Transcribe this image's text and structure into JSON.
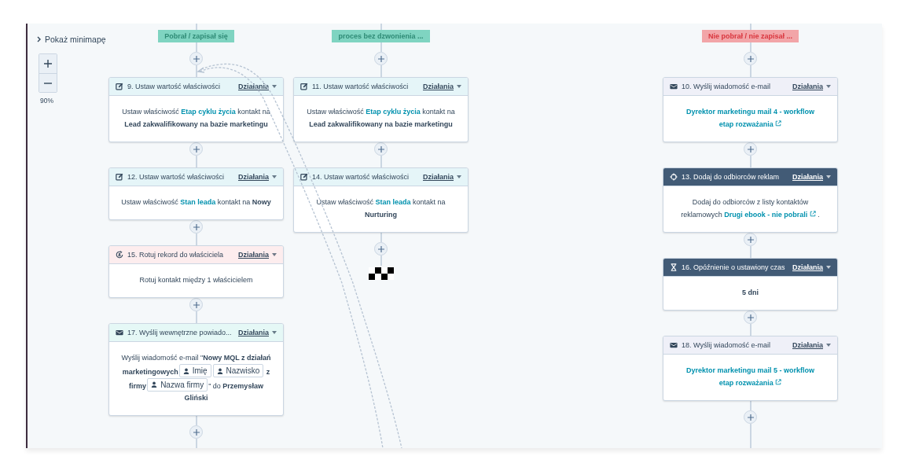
{
  "canvas": {
    "minimap_toggle": "Pokaż minimapę",
    "zoom_level": "90%"
  },
  "branches": [
    {
      "label": "Pobrał / zapisał się",
      "kind": "success",
      "ends": false,
      "steps": [
        {
          "title": "9. Ustaw wartość właściwości",
          "kind": "set_property",
          "actions": "Działania",
          "body": [
            {
              "kind": "text",
              "text": "Ustaw właściwość "
            },
            {
              "kind": "link",
              "text": "Etap cyklu życia"
            },
            {
              "kind": "text",
              "text": " kontakt na "
            },
            {
              "kind": "bold",
              "text": "Lead zakwalifikowany na bazie marketingu"
            }
          ]
        },
        {
          "title": "12. Ustaw wartość właściwości",
          "kind": "set_property",
          "actions": "Działania",
          "body": [
            {
              "kind": "text",
              "text": "Ustaw właściwość "
            },
            {
              "kind": "link",
              "text": "Stan leada"
            },
            {
              "kind": "text",
              "text": " kontakt na "
            },
            {
              "kind": "bold",
              "text": "Nowy"
            }
          ]
        },
        {
          "title": "15. Rotuj rekord do właściciela",
          "kind": "rotate",
          "actions": "Działania",
          "body": [
            {
              "kind": "text",
              "text": "Rotuj kontakt między 1 właścicielem"
            }
          ]
        },
        {
          "title": "17. Wyślij wewnętrzne powiado...",
          "kind": "internal_email",
          "actions": "Działania",
          "body": [
            {
              "kind": "text",
              "text": "Wyślij wiadomość e-mail \""
            },
            {
              "kind": "bold",
              "text": "Nowy MQL z działań marketingowych"
            },
            {
              "kind": "token",
              "text": "Imię"
            },
            {
              "kind": "token",
              "text": "Nazwisko"
            },
            {
              "kind": "bold",
              "text": " z firmy"
            },
            {
              "kind": "token",
              "text": "Nazwa firmy"
            },
            {
              "kind": "text",
              "text": "\" do "
            },
            {
              "kind": "bold",
              "text": "Przemysław Gliński"
            }
          ]
        }
      ]
    },
    {
      "label": "proces bez dzwonienia ...",
      "kind": "success",
      "ends": true,
      "steps": [
        {
          "title": "11. Ustaw wartość właściwości",
          "kind": "set_property",
          "actions": "Działania",
          "body": [
            {
              "kind": "text",
              "text": "Ustaw właściwość "
            },
            {
              "kind": "link",
              "text": "Etap cyklu życia"
            },
            {
              "kind": "text",
              "text": " kontakt na "
            },
            {
              "kind": "bold",
              "text": "Lead zakwalifikowany na bazie marketingu"
            }
          ]
        },
        {
          "title": "14. Ustaw wartość właściwości",
          "kind": "set_property",
          "actions": "Działania",
          "body": [
            {
              "kind": "text",
              "text": "Ustaw właściwość "
            },
            {
              "kind": "link",
              "text": "Stan leada"
            },
            {
              "kind": "text",
              "text": " kontakt na "
            },
            {
              "kind": "bold",
              "text": "Nurturing"
            }
          ]
        }
      ]
    },
    {
      "label": "Nie pobrał / nie zapisał ...",
      "kind": "danger",
      "ends": false,
      "steps": [
        {
          "title": "10. Wyślij wiadomość e-mail",
          "kind": "email",
          "actions": "Działania",
          "body": [
            {
              "kind": "extlink",
              "text": "Dyrektor marketingu mail 4 - workflow etap rozważania"
            }
          ]
        },
        {
          "title": "13. Dodaj do odbiorców reklam",
          "kind": "ads",
          "actions": "Działania",
          "body": [
            {
              "kind": "text",
              "text": "Dodaj do odbiorców z listy kontaktów reklamowych "
            },
            {
              "kind": "extlink",
              "text": "Drugi ebook - nie pobrali"
            },
            {
              "kind": "text",
              "text": " ."
            }
          ]
        },
        {
          "title": "16. Opóźnienie o ustawiony czas",
          "kind": "delay",
          "actions": "Działania",
          "body": [
            {
              "kind": "bold",
              "text": "5 dni"
            }
          ]
        },
        {
          "title": "18. Wyślij wiadomość e-mail",
          "kind": "email",
          "actions": "Działania",
          "body": [
            {
              "kind": "extlink",
              "text": "Dyrektor marketingu mail 5 - workflow etap rozważania"
            }
          ]
        }
      ]
    }
  ]
}
